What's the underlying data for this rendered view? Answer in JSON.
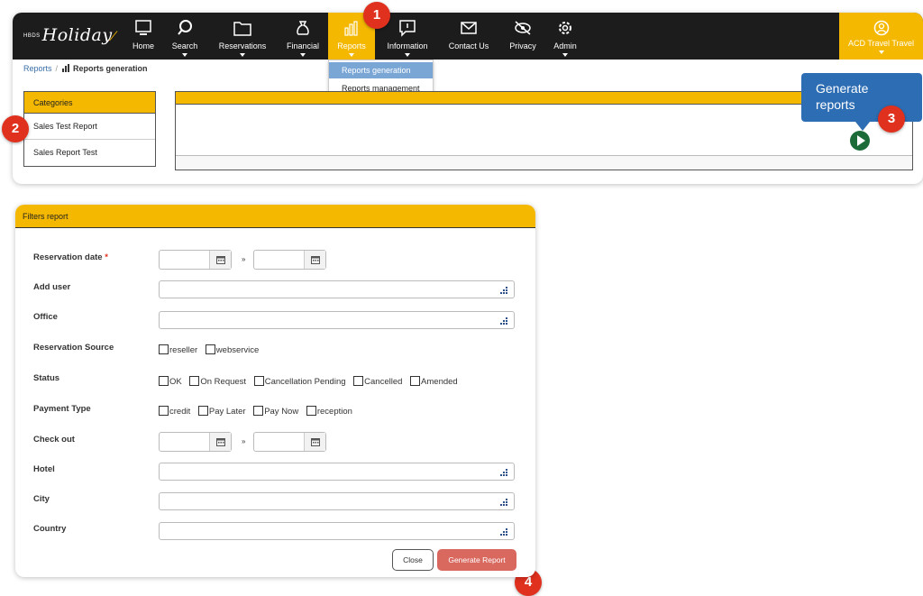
{
  "header": {
    "logo_small": "HBDS",
    "logo_text": "Holiday",
    "nav": [
      {
        "label": "Home",
        "icon": "monitor-icon",
        "caret": false
      },
      {
        "label": "Search",
        "icon": "search-icon",
        "caret": true
      },
      {
        "label": "Reservations",
        "icon": "folder-icon",
        "caret": true
      },
      {
        "label": "Financial",
        "icon": "money-bag-icon",
        "caret": true
      },
      {
        "label": "Reports",
        "icon": "bar-chart-icon",
        "caret": true,
        "active": true
      },
      {
        "label": "Information",
        "icon": "info-message-icon",
        "caret": true
      },
      {
        "label": "Contact Us",
        "icon": "envelope-icon",
        "caret": false
      },
      {
        "label": "Privacy",
        "icon": "eye-slash-icon",
        "caret": false
      },
      {
        "label": "Admin",
        "icon": "gear-icon",
        "caret": true
      }
    ],
    "user": "ACD Travel Travel"
  },
  "reports_menu": [
    "Reports generation",
    "Reports management"
  ],
  "breadcrumb": {
    "root": "Reports",
    "sep": "/",
    "current": "Reports generation"
  },
  "categories": {
    "title": "Categories",
    "items": [
      "Sales Test Report",
      "Sales Report Test"
    ]
  },
  "tooltip": {
    "line1": "Generate",
    "line2": "reports"
  },
  "badges": [
    "1",
    "2",
    "3",
    "4"
  ],
  "filters": {
    "title": "Filters report",
    "reservation_date": "Reservation date",
    "required_mark": "*",
    "range_sep": "»",
    "add_user": "Add user",
    "office": "Office",
    "reservation_source": "Reservation Source",
    "source_options": [
      "reseller",
      "webservice"
    ],
    "status": "Status",
    "status_options": [
      "OK",
      "On Request",
      "Cancellation Pending",
      "Cancelled",
      "Amended"
    ],
    "payment_type": "Payment Type",
    "payment_options": [
      "credit",
      "Pay Later",
      "Pay Now",
      "reception"
    ],
    "check_out": "Check out",
    "hotel": "Hotel",
    "city": "City",
    "country": "Country",
    "close_label": "Close",
    "generate_label": "Generate Report"
  },
  "colors": {
    "accent": "#f5b800",
    "navbar": "#1c1c1c",
    "badge": "#e0301e",
    "tooltip": "#2d6db3",
    "generate": "#d9685f",
    "play": "#1e6b3a"
  }
}
